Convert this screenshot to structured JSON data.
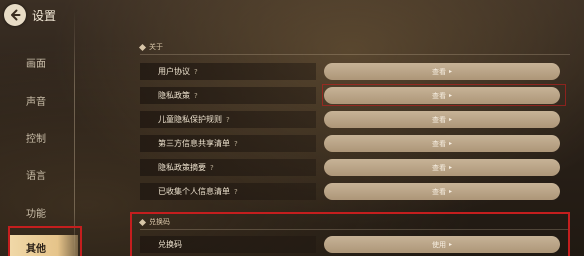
{
  "header": {
    "title": "设置"
  },
  "sidebar": {
    "items": [
      {
        "label": "画面"
      },
      {
        "label": "声音"
      },
      {
        "label": "控制"
      },
      {
        "label": "语言"
      },
      {
        "label": "功能"
      },
      {
        "label": "其他"
      }
    ],
    "active_index": 5
  },
  "sections": [
    {
      "title": "关于",
      "rows": [
        {
          "label": "用户协议",
          "help": "?",
          "action": "查看",
          "arrow": "▸"
        },
        {
          "label": "隐私政策",
          "help": "?",
          "action": "查看",
          "arrow": "▸"
        },
        {
          "label": "儿童隐私保护规则",
          "help": "?",
          "action": "查看",
          "arrow": "▸"
        },
        {
          "label": "第三方信息共享清单",
          "help": "?",
          "action": "查看",
          "arrow": "▸"
        },
        {
          "label": "隐私政策摘要",
          "help": "?",
          "action": "查看",
          "arrow": "▸"
        },
        {
          "label": "已收集个人信息清单",
          "help": "?",
          "action": "查看",
          "arrow": "▸"
        }
      ]
    },
    {
      "title": "兑换码",
      "rows": [
        {
          "label": "兑换码",
          "help": "",
          "action": "使用",
          "arrow": "▸"
        }
      ]
    }
  ],
  "colors": {
    "accent_active": "#e6c48a",
    "button": "#b9a282",
    "highlight": "#c41e1e"
  }
}
